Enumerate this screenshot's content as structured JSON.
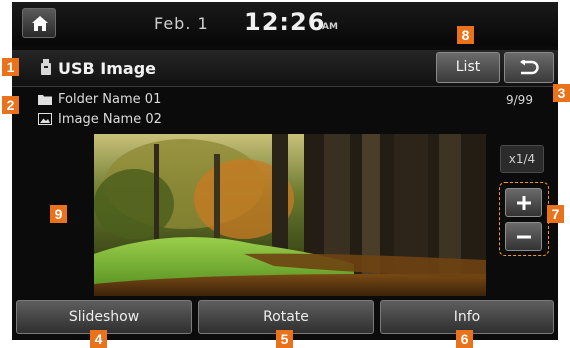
{
  "status_bar": {
    "date": "Feb. 1",
    "time": "12:26",
    "ampm": "AM"
  },
  "title_bar": {
    "title": "USB Image",
    "list_label": "List"
  },
  "file_info": {
    "folder_name": "Folder Name 01",
    "image_name": "Image Name 02",
    "counter": "9/99"
  },
  "zoom": {
    "level": "x1/4"
  },
  "bottom_buttons": {
    "slideshow": "Slideshow",
    "rotate": "Rotate",
    "info": "Info"
  },
  "callouts": [
    "1",
    "2",
    "3",
    "4",
    "5",
    "6",
    "7",
    "8",
    "9"
  ],
  "colors": {
    "marker": "#e8731c",
    "background": "#0b0b0b"
  },
  "icons": [
    "home-icon",
    "usb-icon",
    "back-icon",
    "folder-icon",
    "image-icon",
    "plus-icon",
    "minus-icon"
  ]
}
